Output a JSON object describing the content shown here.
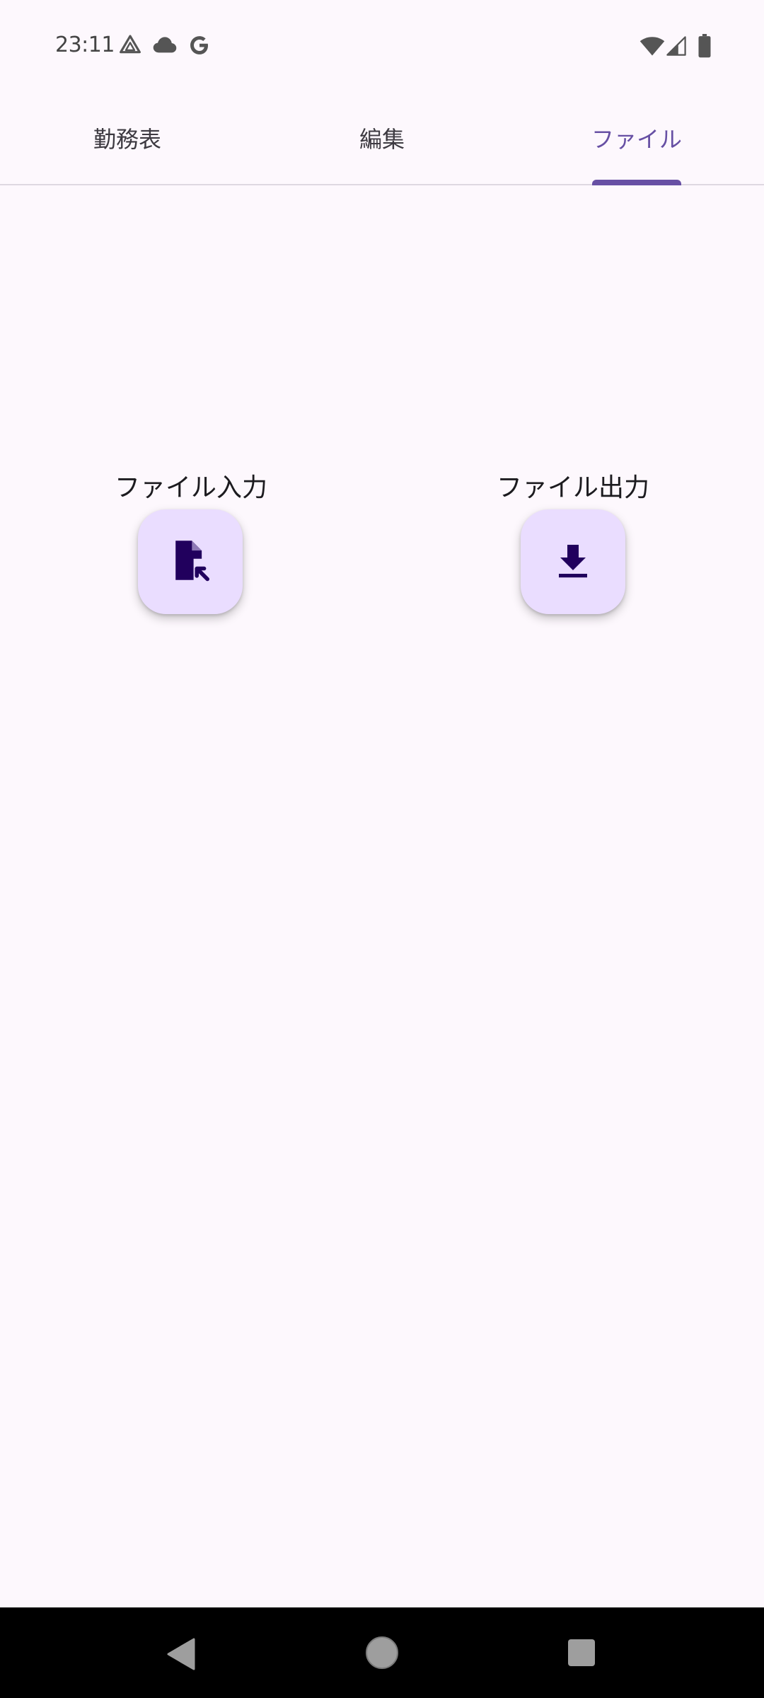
{
  "status_bar": {
    "time": "23:11",
    "notification_icons": [
      "drive-icon",
      "cloud-icon",
      "google-icon"
    ],
    "system_icons": [
      "wifi-icon",
      "cell-signal-icon",
      "battery-icon"
    ]
  },
  "tabs": [
    {
      "label": "勤務表",
      "active": false
    },
    {
      "label": "編集",
      "active": false
    },
    {
      "label": "ファイル",
      "active": true
    }
  ],
  "actions": {
    "import": {
      "label": "ファイル入力",
      "icon": "file-open-icon"
    },
    "export": {
      "label": "ファイル出力",
      "icon": "download-icon"
    }
  },
  "nav_bar": {
    "buttons": [
      "back-icon",
      "home-icon",
      "recents-icon"
    ]
  },
  "colors": {
    "accent": "#6750A4",
    "fab_bg": "#EADDFF",
    "fab_icon": "#21005D",
    "background": "#FDF8FD"
  }
}
